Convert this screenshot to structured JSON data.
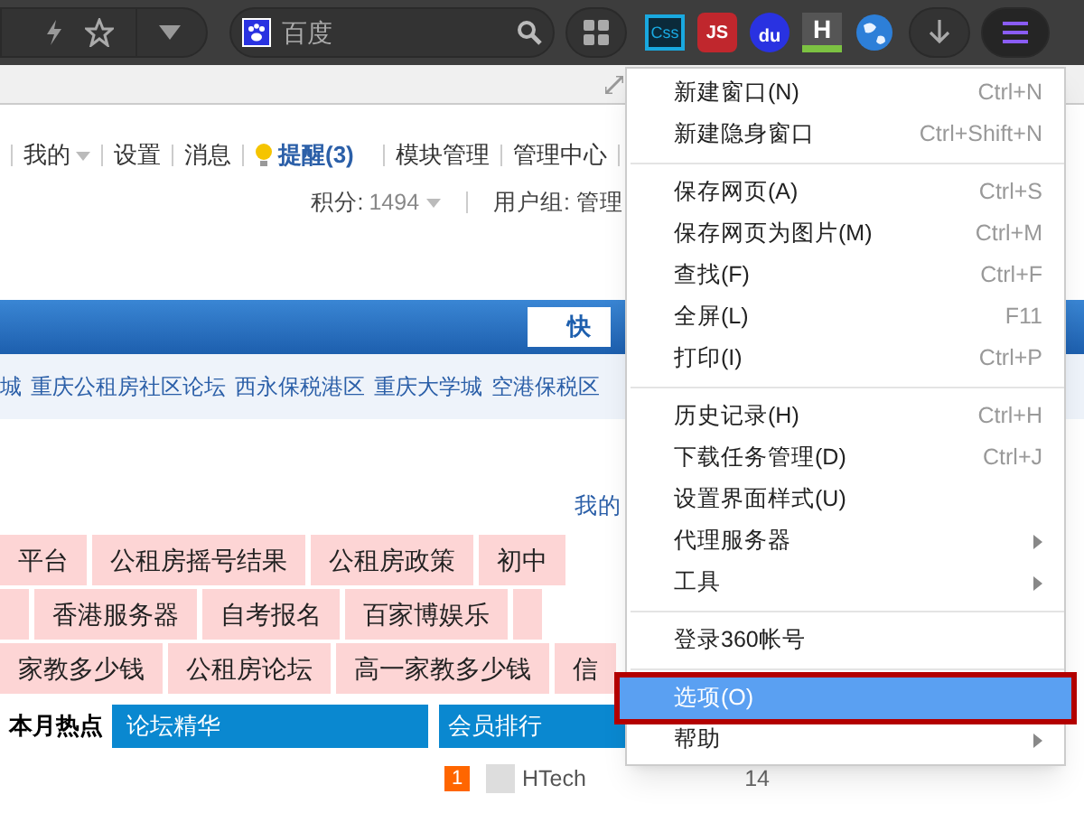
{
  "toolbar": {
    "search_placeholder": "百度",
    "extensions": [
      {
        "kind": "css",
        "label": "Css"
      },
      {
        "kind": "js",
        "label": "JS"
      },
      {
        "kind": "du",
        "label": "du"
      },
      {
        "kind": "h",
        "label": "H"
      },
      {
        "kind": "globe"
      }
    ],
    "menu_open": true
  },
  "user_nav": {
    "items": [
      {
        "label": "我的",
        "dropdown": true
      },
      {
        "label": "设置"
      },
      {
        "label": "消息"
      },
      {
        "label": "提醒(3)",
        "kind": "alert"
      },
      {
        "label": "模块管理"
      },
      {
        "label": "管理中心"
      }
    ]
  },
  "user_info": {
    "points_label": "积分:",
    "points": "1494",
    "group": "用户组: 管理"
  },
  "search_button": "快",
  "quick_links": [
    "城",
    "重庆公租房社区论坛",
    "西永保税港区",
    "重庆大学城",
    "空港保税区"
  ],
  "my_link": "我的",
  "tag_rows": [
    [
      "平台",
      "公租房摇号结果",
      "公租房政策",
      "初中"
    ],
    [
      "",
      "香港服务器",
      "自考报名",
      "百家博娱乐",
      ""
    ],
    [
      "家教多少钱",
      "公租房论坛",
      "高一家教多少钱",
      "信"
    ]
  ],
  "panels": {
    "tabs": [
      {
        "label": "本月热点",
        "selected": true
      },
      {
        "label": "论坛精华",
        "selected": false
      }
    ],
    "ranking_title": "会员排行",
    "ranking": [
      {
        "rank": "1",
        "name": "HTech",
        "count": "14"
      }
    ]
  },
  "menu": [
    {
      "kind": "item",
      "label": "新建窗口(N)",
      "shortcut": "Ctrl+N",
      "selected": false
    },
    {
      "kind": "item",
      "label": "新建隐身窗口",
      "shortcut": "Ctrl+Shift+N",
      "selected": false
    },
    {
      "kind": "separator"
    },
    {
      "kind": "item",
      "label": "保存网页(A)",
      "shortcut": "Ctrl+S",
      "selected": false
    },
    {
      "kind": "item",
      "label": "保存网页为图片(M)",
      "shortcut": "Ctrl+M",
      "selected": false
    },
    {
      "kind": "item",
      "label": "查找(F)",
      "shortcut": "Ctrl+F",
      "selected": false
    },
    {
      "kind": "item",
      "label": "全屏(L)",
      "shortcut": "F11",
      "selected": false
    },
    {
      "kind": "item",
      "label": "打印(I)",
      "shortcut": "Ctrl+P",
      "selected": false
    },
    {
      "kind": "separator"
    },
    {
      "kind": "item",
      "label": "历史记录(H)",
      "shortcut": "Ctrl+H",
      "selected": false
    },
    {
      "kind": "item",
      "label": "下载任务管理(D)",
      "shortcut": "Ctrl+J",
      "selected": false
    },
    {
      "kind": "item",
      "label": "设置界面样式(U)",
      "selected": false
    },
    {
      "kind": "submenu",
      "label": "代理服务器",
      "selected": false
    },
    {
      "kind": "submenu",
      "label": "工具",
      "selected": false
    },
    {
      "kind": "separator"
    },
    {
      "kind": "item",
      "label": "登录360帐号",
      "selected": false
    },
    {
      "kind": "separator"
    },
    {
      "kind": "item",
      "label": "选项(O)",
      "selected": true
    },
    {
      "kind": "submenu",
      "label": "帮助",
      "selected": false
    }
  ]
}
